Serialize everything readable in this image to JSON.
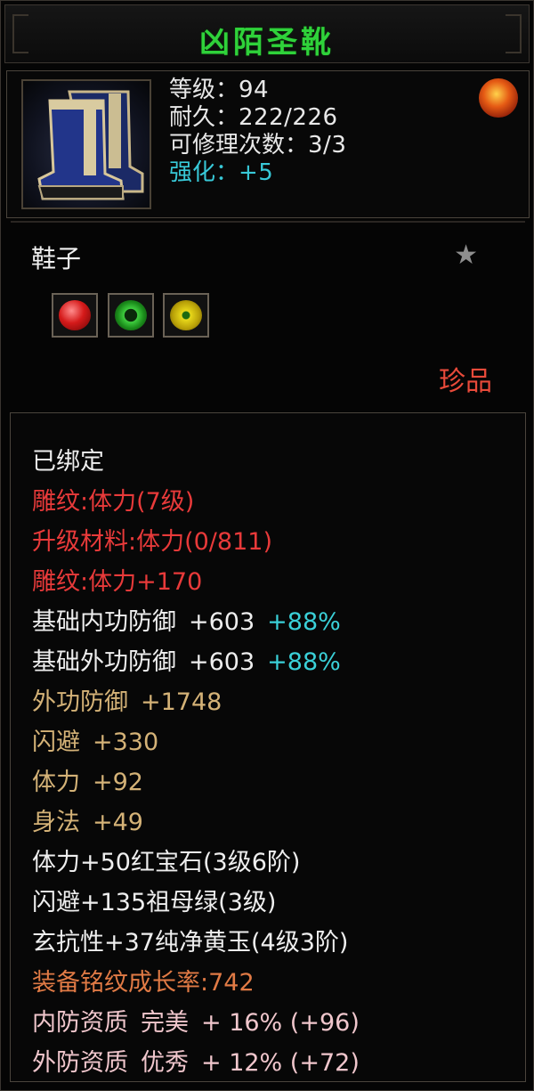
{
  "title": "凶陌圣靴",
  "header": {
    "level_label": "等级：",
    "level": "94",
    "durability_label": "耐久：",
    "durability": "222/226",
    "repairs_label": "可修理次数：",
    "repairs": "3/3",
    "enhance_label": "强化：",
    "enhance": "+5"
  },
  "item_type": "鞋子",
  "rarity": "珍品",
  "icons": {
    "item": "boots-icon",
    "badge": "dragon-emblem-icon",
    "favorite": "star-icon",
    "gems": [
      "ruby-gem-icon",
      "emerald-gem-icon",
      "yellow-jade-gem-icon"
    ]
  },
  "colors": {
    "title": "#2fd23a",
    "red": "#e83a3a",
    "tan": "#d4b277",
    "cyan": "#3ad0d8",
    "orange": "#e07a45",
    "pink": "#f0c6cc"
  },
  "details": {
    "bound": "已绑定",
    "engrave_level": "雕纹:体力(7级)",
    "upgrade_material": "升级材料:体力(0/811)",
    "engrave_bonus": "雕纹:体力+170",
    "base_inner_def": {
      "label": "基础内功防御",
      "value": "+603",
      "bonus": "+88%"
    },
    "base_outer_def": {
      "label": "基础外功防御",
      "value": "+603",
      "bonus": "+88%"
    },
    "outer_def": {
      "label": "外功防御",
      "value": "+1748"
    },
    "dodge": {
      "label": "闪避",
      "value": "+330"
    },
    "stamina": {
      "label": "体力",
      "value": "+92"
    },
    "agility": {
      "label": "身法",
      "value": "+49"
    },
    "gem1": "体力+50红宝石(3级6阶)",
    "gem2": "闪避+135祖母绿(3级)",
    "gem3": "玄抗性+37纯净黄玉(4级3阶)",
    "growth": "装备铭纹成长率:742",
    "inner_quality": {
      "label": "内防资质",
      "grade": "完美",
      "value": "+ 16% (+96)"
    },
    "outer_quality": {
      "label": "外防资质",
      "grade": "优秀",
      "value": "+ 12% (+72)"
    }
  }
}
